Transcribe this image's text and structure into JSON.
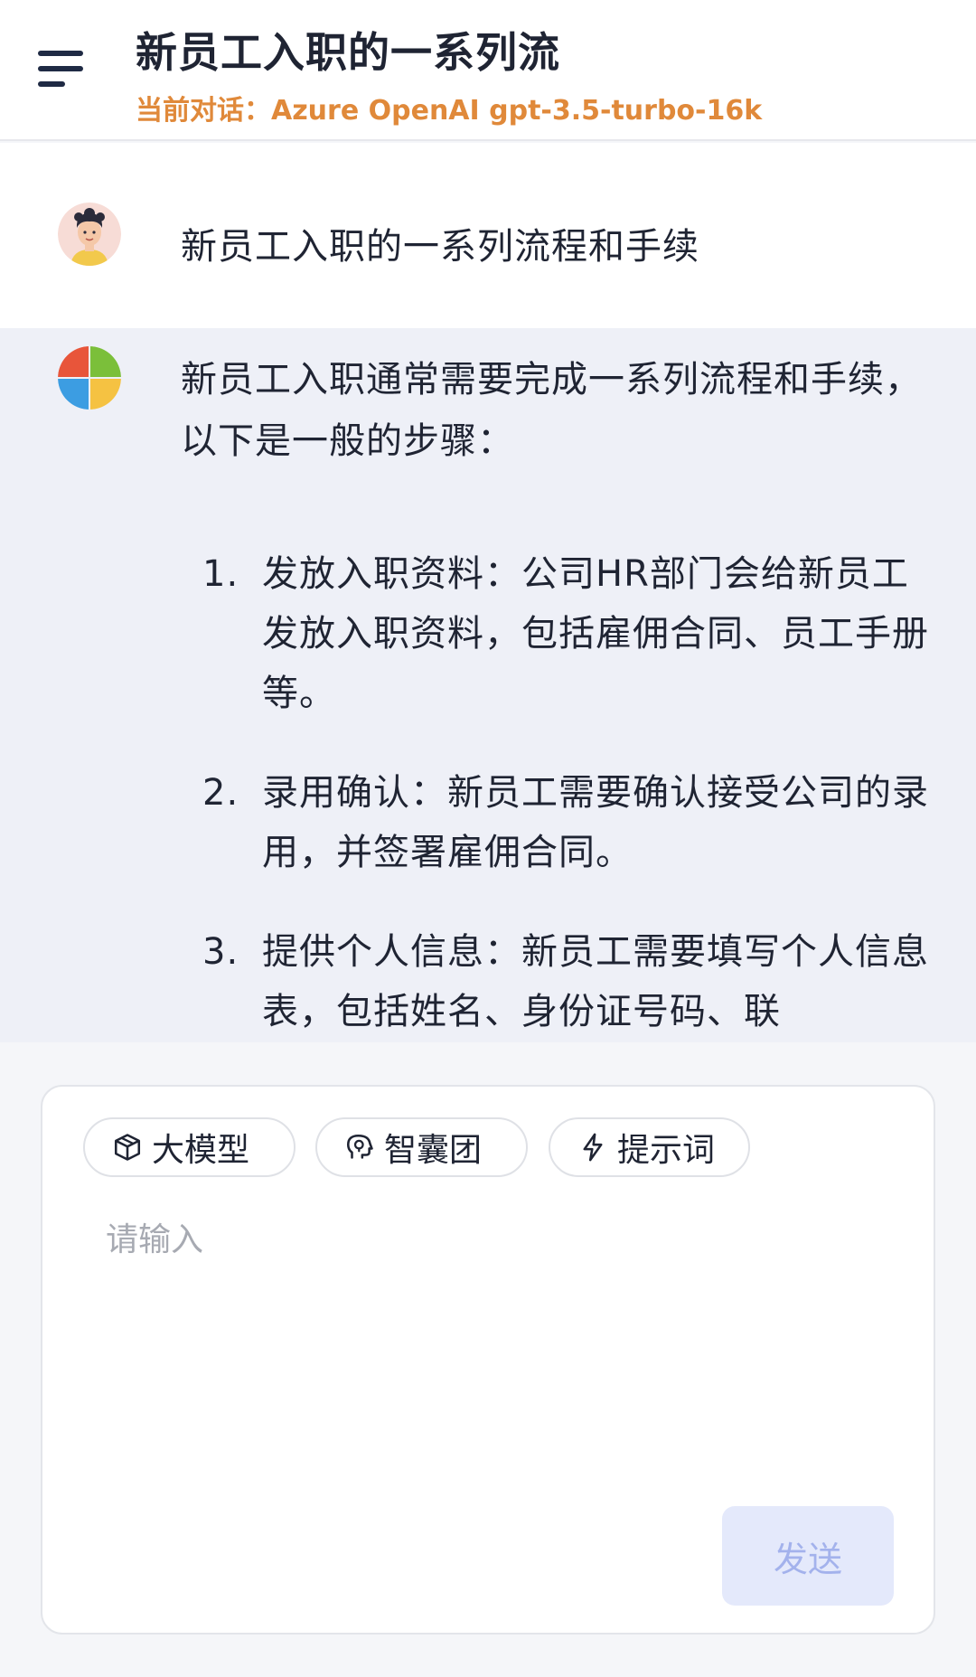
{
  "header": {
    "title": "新员工入职的一系列流",
    "subtitle": "当前对话：Azure OpenAI gpt-3.5-turbo-16k",
    "menu_icon": "menu-icon"
  },
  "messages": {
    "user": {
      "avatar_icon": "user-avatar-icon",
      "text": "新员工入职的一系列流程和手续"
    },
    "assistant": {
      "avatar_icon": "assistant-avatar-icon",
      "intro": "新员工入职通常需要完成一系列流程和手续，以下是一般的步骤：",
      "steps": [
        {
          "num": "1.",
          "text": "发放入职资料：公司HR部门会给新员工发放入职资料，包括雇佣合同、员工手册等。"
        },
        {
          "num": "2.",
          "text": "录用确认：新员工需要确认接受公司的录用，并签署雇佣合同。"
        },
        {
          "num": "3.",
          "text": "提供个人信息：新员工需要填写个人信息表，包括姓名、身份证号码、联"
        }
      ]
    }
  },
  "composer": {
    "chips": [
      {
        "label": "大模型",
        "icon": "cube-icon"
      },
      {
        "label": "智囊团",
        "icon": "brain-icon"
      },
      {
        "label": "提示词",
        "icon": "lightning-icon"
      }
    ],
    "placeholder": "请输入",
    "send_label": "发送"
  },
  "colors": {
    "accent_orange": "#e0893a",
    "send_bg": "#e4e9fb",
    "send_text": "#a3b2ec",
    "assistant_bg": "#eef0f7"
  }
}
